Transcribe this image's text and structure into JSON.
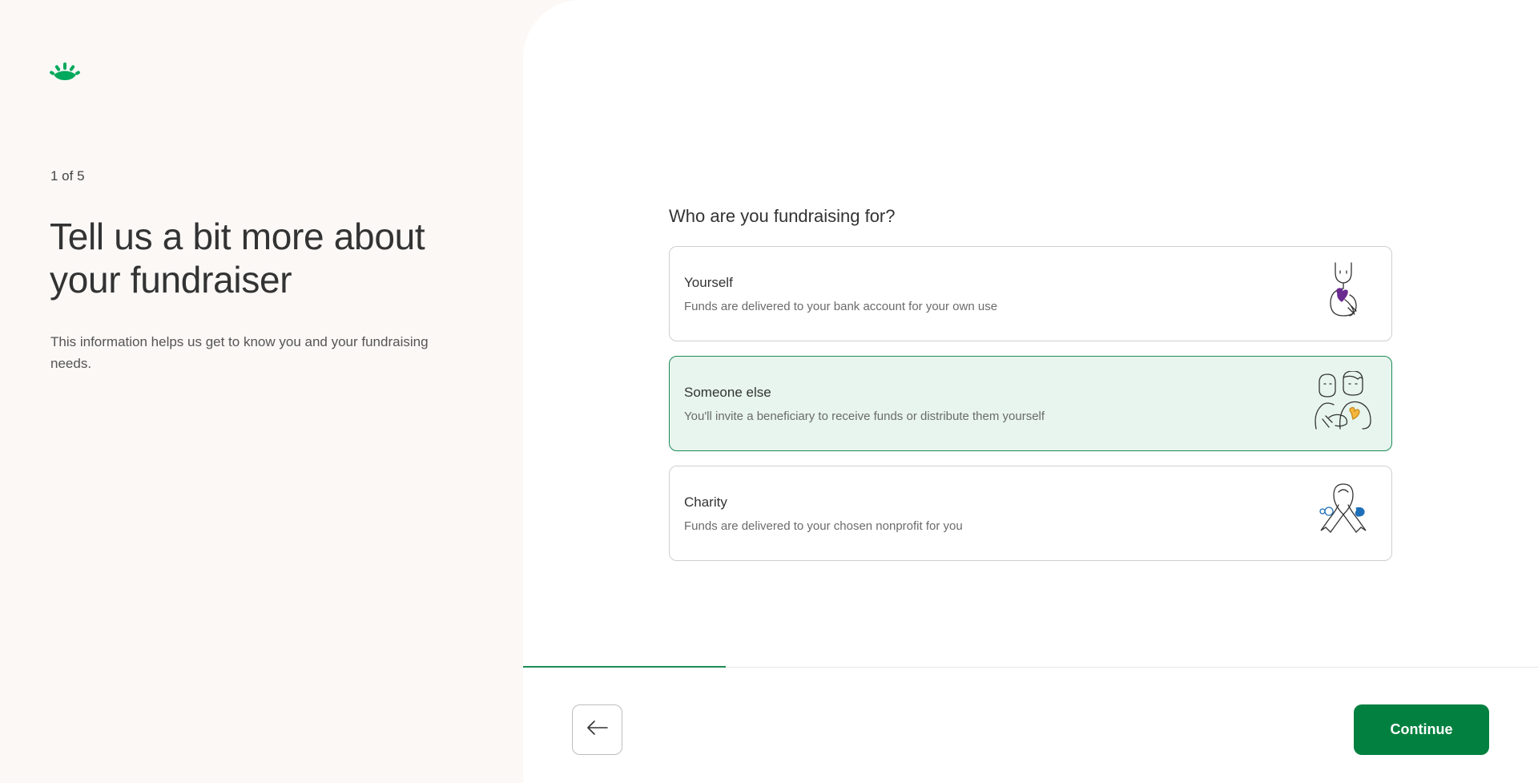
{
  "left": {
    "step_indicator": "1 of 5",
    "title": "Tell us a bit more about your fundraiser",
    "description": "This information helps us get to know you and your fundraising needs."
  },
  "logo": {
    "icon": "sprout-logo-icon",
    "color": "#02a95c"
  },
  "form": {
    "question": "Who are you fundraising for?",
    "options": [
      {
        "title": "Yourself",
        "description": "Funds are delivered to your bank account for your own use",
        "icon": "person-with-heart-illustration-icon",
        "selected": false
      },
      {
        "title": "Someone else",
        "description": "You'll invite a beneficiary to receive funds or distribute them yourself",
        "icon": "two-people-illustration-icon",
        "selected": true
      },
      {
        "title": "Charity",
        "description": "Funds are delivered to your chosen nonprofit for you",
        "icon": "awareness-ribbon-illustration-icon",
        "selected": false
      }
    ]
  },
  "progress": {
    "step": 1,
    "total": 5,
    "fraction": 0.2
  },
  "footer": {
    "back_icon": "arrow-left-icon",
    "continue_label": "Continue"
  },
  "colors": {
    "accent": "#02803f",
    "selected_bg": "#e7f5ee",
    "selected_border": "#1d8a55",
    "left_bg": "#fbf8f6"
  }
}
